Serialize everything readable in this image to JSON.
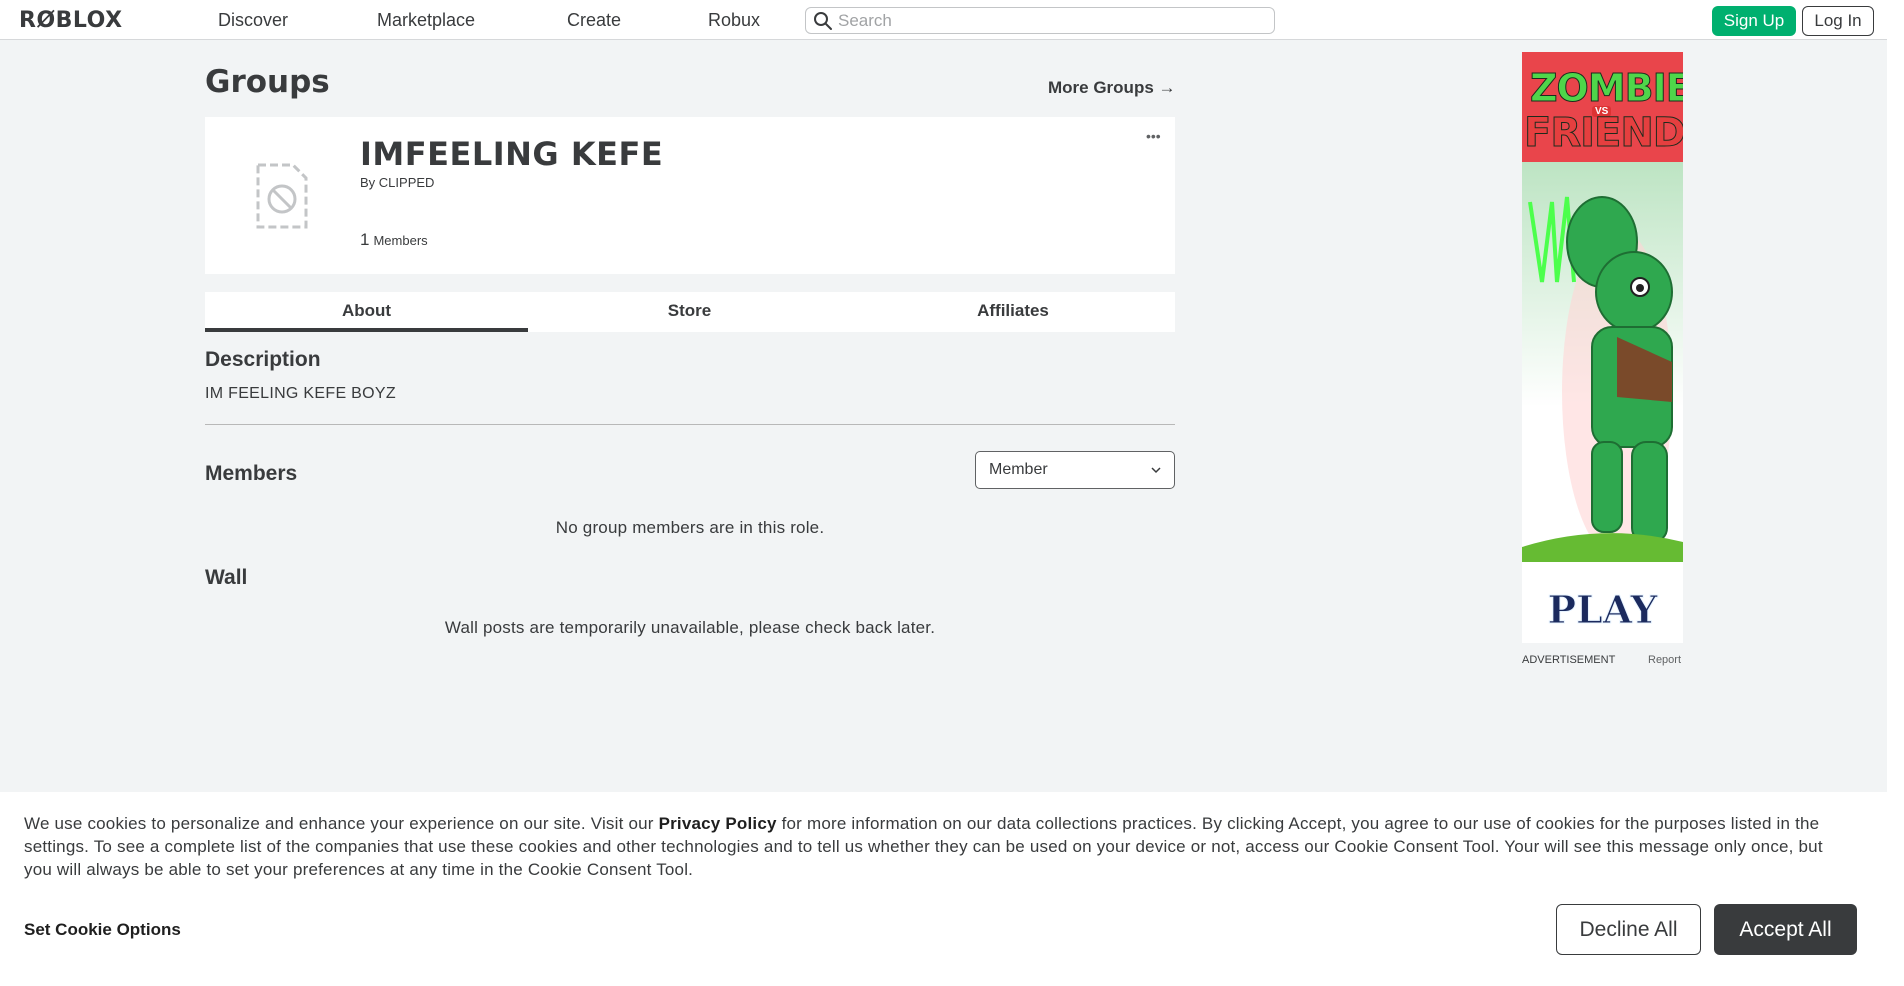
{
  "nav": {
    "logo": "RØBLOX",
    "links": [
      "Discover",
      "Marketplace",
      "Create",
      "Robux"
    ],
    "search_placeholder": "Search",
    "signup_label": "Sign Up",
    "login_label": "Log In"
  },
  "page": {
    "title": "Groups",
    "more_groups": "More Groups",
    "more_groups_arrow": "→"
  },
  "group": {
    "name": "IMFEELING KEFE",
    "by_prefix": "By",
    "owner": "CLIPPED",
    "member_count": "1",
    "member_label": "Members",
    "more_menu": "•••"
  },
  "tabs": [
    "About",
    "Store",
    "Affiliates"
  ],
  "active_tab": "About",
  "description": {
    "title": "Description",
    "text": "IM FEELING KEFE BOYZ"
  },
  "members": {
    "title": "Members",
    "role_selected": "Member",
    "empty_message": "No group members are in this role."
  },
  "wall": {
    "title": "Wall",
    "message": "Wall posts are temporarily unavailable, please check back later."
  },
  "ad": {
    "title_line1": "ZOMBIE",
    "title_vs": "VS",
    "title_line2": "FRIEND",
    "cta": "PLAY",
    "label": "ADVERTISEMENT",
    "report": "Report"
  },
  "cookie": {
    "text_before": "We use cookies to personalize and enhance your experience on our site. Visit our ",
    "privacy_link": "Privacy Policy",
    "text_after": " for more information on our data collections practices. By clicking Accept, you agree to our use of cookies for the purposes listed in the settings. To see a complete list of the companies that use these cookies and other technologies and to tell us whether they can be used on your device or not, access our Cookie Consent Tool. Your will see this message only once, but you will always be able to set your preferences at any time in the Cookie Consent Tool.",
    "options_label": "Set Cookie Options",
    "decline_label": "Decline All",
    "accept_label": "Accept All"
  },
  "colors": {
    "accent_green": "#00b06f",
    "text_dark": "#393b3d",
    "page_bg": "#f2f4f5"
  }
}
